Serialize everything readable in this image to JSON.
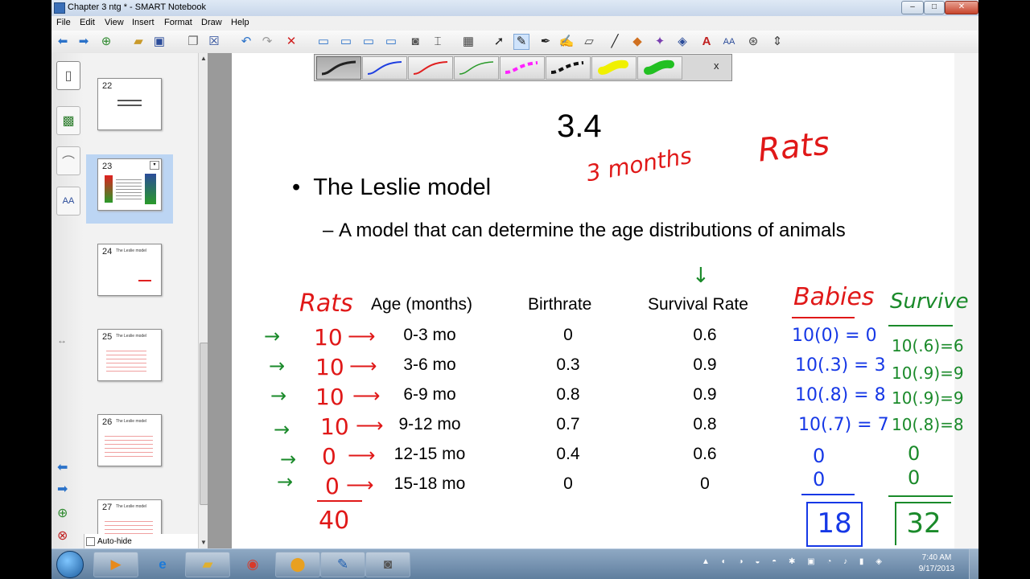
{
  "window": {
    "title": "Chapter 3 ntg * - SMART Notebook"
  },
  "menu": [
    "File",
    "Edit",
    "View",
    "Insert",
    "Format",
    "Draw",
    "Help"
  ],
  "toolbar_icons": [
    "back-icon",
    "forward-icon",
    "add-page-icon",
    "open-icon",
    "save-icon",
    "paste-icon",
    "delete-page-icon",
    "undo-icon",
    "redo-icon",
    "delete-icon",
    "screen-shade-icon",
    "display-icon",
    "dual-display-icon",
    "capture-icon",
    "document-camera-icon",
    "table-icon",
    "select-icon",
    "pen-icon",
    "creative-pen-icon",
    "magic-pen-icon",
    "eraser-icon",
    "line-icon",
    "shapes-icon",
    "magic-wand-icon",
    "fill-icon",
    "text-icon",
    "properties-icon",
    "measure-icon",
    "move-toolbar-icon"
  ],
  "pen_palette": {
    "close": "x",
    "pens": [
      {
        "color": "#222222",
        "style": "solid"
      },
      {
        "color": "#1f3fe0",
        "style": "solid"
      },
      {
        "color": "#e02020",
        "style": "solid"
      },
      {
        "color": "#2a9a2a",
        "style": "solid"
      },
      {
        "color": "#ff22ff",
        "style": "dashed"
      },
      {
        "color": "#111111",
        "style": "dashed"
      },
      {
        "color": "#f0f000",
        "style": "highlighter"
      },
      {
        "color": "#22c022",
        "style": "highlighter"
      }
    ]
  },
  "sorter": {
    "pages": [
      {
        "num": "22",
        "caption": ""
      },
      {
        "num": "23",
        "caption": ""
      },
      {
        "num": "24",
        "caption": "The Leslie model"
      },
      {
        "num": "25",
        "caption": "The Leslie model"
      },
      {
        "num": "26",
        "caption": "The Leslie model"
      },
      {
        "num": "27",
        "caption": "The Leslie model"
      }
    ],
    "selected": "23",
    "autohide_label": "Auto-hide"
  },
  "slide": {
    "title": "3.4",
    "bullet": "The Leslie model",
    "sub_dash": "–",
    "sub": "A model that can determine the age distributions of animals",
    "headers": [
      "Age (months)",
      "Birthrate",
      "Survival Rate"
    ],
    "rows": [
      {
        "age": "0-3 mo",
        "birth": "0",
        "survival": "0.6"
      },
      {
        "age": "3-6 mo",
        "birth": "0.3",
        "survival": "0.9"
      },
      {
        "age": "6-9 mo",
        "birth": "0.8",
        "survival": "0.9"
      },
      {
        "age": "9-12 mo",
        "birth": "0.7",
        "survival": "0.8"
      },
      {
        "age": "12-15 mo",
        "birth": "0.4",
        "survival": "0.6"
      },
      {
        "age": "15-18 mo",
        "birth": "0",
        "survival": "0"
      }
    ]
  },
  "ink": {
    "top_note": "3 months",
    "top_rats": "Rats",
    "col_rats": "Rats",
    "rat_counts": [
      "10",
      "10",
      "10",
      "10",
      "0",
      "0"
    ],
    "rat_total": "40",
    "babies_header": "Babies",
    "babies": [
      "10(0) = 0",
      "10(.3) = 3",
      "10(.8) = 8",
      "10(.7) = 7",
      "0",
      "0"
    ],
    "babies_total": "18",
    "survive_header": "Survive",
    "survive": [
      "10(.6)=6",
      "10(.9)=9",
      "10(.9)=9",
      "10(.8)=8",
      "0",
      "0"
    ],
    "survive_total": "32"
  },
  "taskbar": {
    "apps": [
      "media-player-icon",
      "internet-explorer-icon",
      "file-explorer-icon",
      "chrome-icon",
      "app-icon",
      "smart-notebook-icon",
      "video-recorder-icon"
    ],
    "time": "7:40 AM",
    "date": "9/17/2013"
  }
}
